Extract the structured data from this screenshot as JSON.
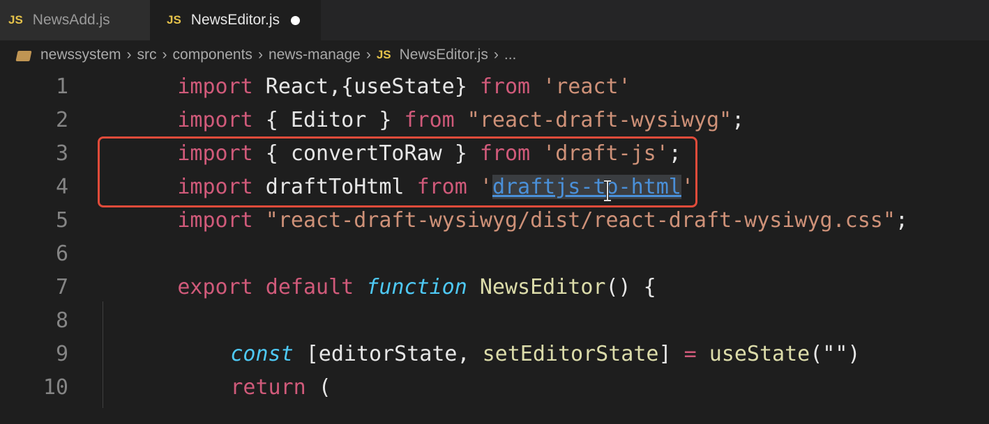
{
  "tabs": [
    {
      "icon": "JS",
      "label": "NewsAdd.js",
      "active": false
    },
    {
      "icon": "JS",
      "label": "NewsEditor.js",
      "active": true,
      "modified": true
    }
  ],
  "breadcrumb": {
    "items": [
      "newssystem",
      "src",
      "components",
      "news-manage"
    ],
    "file_icon": "JS",
    "file": "NewsEditor.js",
    "tail": "..."
  },
  "code": {
    "lines": [
      {
        "n": "1"
      },
      {
        "n": "2"
      },
      {
        "n": "3"
      },
      {
        "n": "4"
      },
      {
        "n": "5"
      },
      {
        "n": "6"
      },
      {
        "n": "7"
      },
      {
        "n": "8"
      },
      {
        "n": "9"
      },
      {
        "n": "10"
      }
    ],
    "l1": {
      "kw": "import",
      "a": " React,{useState} ",
      "from": "from",
      "str": " 'react'"
    },
    "l2": {
      "kw": "import",
      "a": " { Editor } ",
      "from": "from",
      "str": " \"react-draft-wysiwyg\"",
      "end": ";"
    },
    "l3": {
      "kw": "import",
      "a": " { convertToRaw } ",
      "from": "from",
      "str": " 'draft-js'",
      "end": ";"
    },
    "l4": {
      "kw": "import",
      "a": " draftToHtml ",
      "from": "from",
      "q1": " '",
      "link": "draftjs-to-html",
      "q2": "'"
    },
    "l5": {
      "kw": "import",
      "str": " \"react-draft-wysiwyg/dist/react-draft-wysiwyg.css\"",
      "end": ";"
    },
    "l7": {
      "kw1": "export",
      "kw2": " default ",
      "fnkw": "function",
      "name": " NewsEditor",
      "rest": "() {"
    },
    "l9": {
      "kw": "const",
      "a": " [editorState, ",
      "b": "setEditorState",
      "c": "] ",
      "eq": "=",
      "d": " ",
      "fn": "useState",
      "e": "(\"\")"
    },
    "l10": {
      "kw": "return",
      "a": " ("
    }
  },
  "colors": {
    "keyword": "#c586c0",
    "string": "#ce9178",
    "function": "#dcdcaa",
    "highlight": "#e14b3a",
    "link": "#4a90d9"
  }
}
